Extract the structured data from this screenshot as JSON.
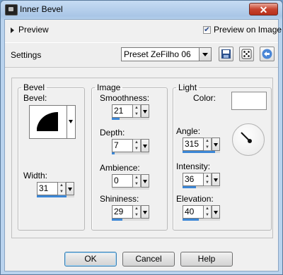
{
  "window": {
    "title": "Inner Bevel",
    "close_glyph": "✕"
  },
  "preview": {
    "label": "Preview",
    "preview_on_image_label": "Preview on Image",
    "preview_on_image_checked": true
  },
  "settings": {
    "label": "Settings",
    "preset_value": "Preset ZeFilho 06",
    "toolbar_icons": [
      "save-icon",
      "randomize-dice-icon",
      "reset-icon"
    ]
  },
  "bevel": {
    "group_label": "Bevel",
    "bevel_label": "Bevel:",
    "width_label": "Width:",
    "width_value": "31",
    "width_fraction": 0.8
  },
  "image": {
    "group_label": "Image",
    "smoothness_label": "Smoothness:",
    "smoothness_value": "21",
    "smoothness_fraction": 0.21,
    "depth_label": "Depth:",
    "depth_value": "7",
    "depth_fraction": 0.07,
    "ambience_label": "Ambience:",
    "ambience_value": "0",
    "ambience_fraction": 0.0,
    "shininess_label": "Shininess:",
    "shininess_value": "29",
    "shininess_fraction": 0.29
  },
  "light": {
    "group_label": "Light",
    "color_label": "Color:",
    "color_value": "#ffffff",
    "angle_label": "Angle:",
    "angle_value": "315",
    "angle_fraction": 0.875,
    "intensity_label": "Intensity:",
    "intensity_value": "36",
    "intensity_fraction": 0.36,
    "elevation_label": "Elevation:",
    "elevation_value": "40",
    "elevation_fraction": 0.44
  },
  "buttons": {
    "ok": "OK",
    "cancel": "Cancel",
    "help": "Help"
  },
  "colors": {
    "accent": "#3c87d6",
    "close_red": "#c7442f",
    "title_bg": "#b9d3ee"
  }
}
